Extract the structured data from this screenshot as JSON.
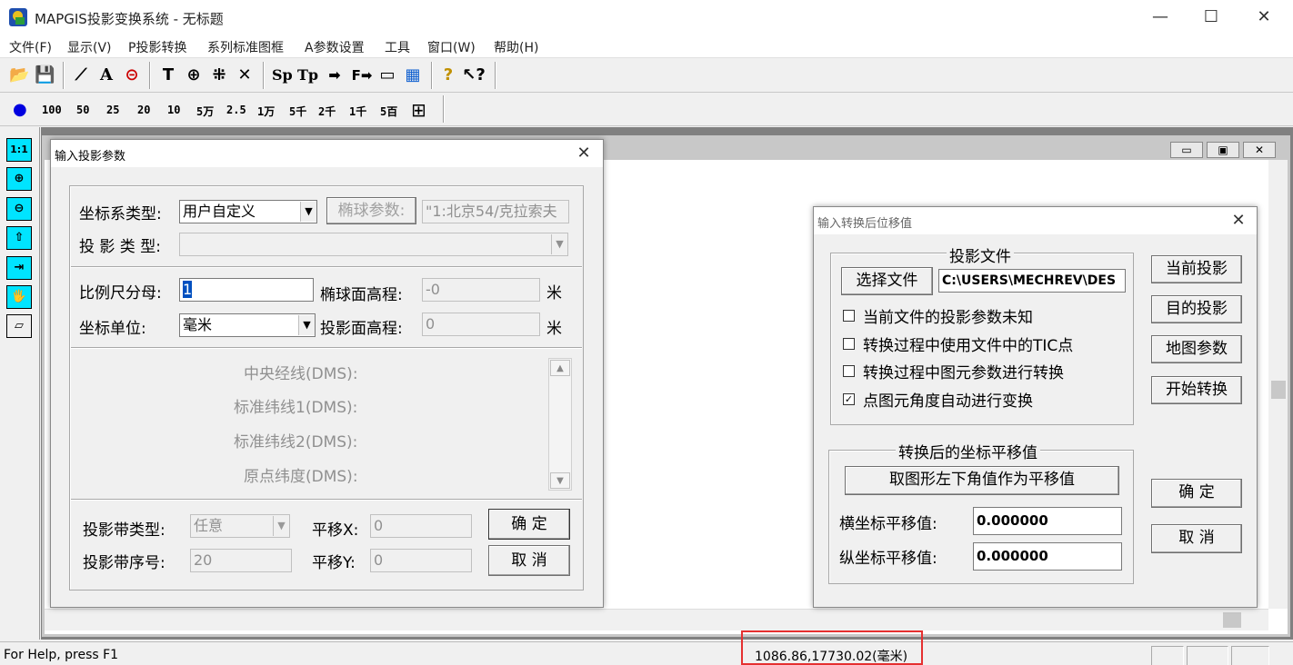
{
  "app": {
    "title": "MAPGIS投影变换系统 - 无标题",
    "minimize": "—",
    "maximize": "☐",
    "close": "✕"
  },
  "menu": [
    "文件(F)",
    "显示(V)",
    "P投影转换",
    "系列标准图框",
    "A参数设置",
    "工具",
    "窗口(W)",
    "帮助(H)"
  ],
  "toolbar1": [
    "📂",
    "💾",
    "⟋",
    "A",
    "⊝",
    "T",
    "⊕",
    "⁜",
    "✕",
    "Sp",
    "Tp",
    "➡",
    "F➡",
    "▭",
    "▦",
    "?",
    "↖?"
  ],
  "toolbar2": {
    "dot": "●",
    "scales": [
      "100",
      "50",
      "25",
      "20",
      "10",
      "5万",
      "2.5",
      "1万",
      "5千",
      "2千",
      "1千",
      "5百"
    ],
    "grid": "⊞"
  },
  "lefttools": [
    "1:1",
    "⊕",
    "⊖",
    "⇧",
    "⇥",
    "🖐",
    "▱"
  ],
  "doc": {
    "min": "▭",
    "restore": "▣",
    "close": "✕"
  },
  "status": {
    "help": "For Help, press F1",
    "coord": "1086.86,17730.02(毫米)"
  },
  "proj_dialog": {
    "title": "输入投影参数",
    "close": "✕",
    "coord_type_label": "坐标系类型:",
    "coord_type_value": "用户自定义",
    "ellipsoid_btn": "椭球参数:",
    "ellipsoid_value": "\"1:北京54/克拉索夫",
    "proj_type_label": "投 影 类 型:",
    "scale_label": "比例尺分母:",
    "scale_value": "1",
    "ell_height_label": "椭球面高程:",
    "ell_height_value": "-0",
    "unit_m1": "米",
    "unit_label": "坐标单位:",
    "unit_value": "毫米",
    "proj_height_label": "投影面高程:",
    "proj_height_value": "0",
    "unit_m2": "米",
    "param_labels": [
      "中央经线(DMS):",
      "标准纬线1(DMS):",
      "标准纬线2(DMS):",
      "原点纬度(DMS):"
    ],
    "zone_type_label": "投影带类型:",
    "zone_type_value": "任意",
    "zone_no_label": "投影带序号:",
    "zone_no_value": "20",
    "shift_x_label": "平移X:",
    "shift_x_value": "0",
    "shift_y_label": "平移Y:",
    "shift_y_value": "0",
    "ok": "确 定",
    "cancel": "取 消"
  },
  "shift_dialog": {
    "title": "输入转换后位移值",
    "close": "✕",
    "group1_title": "投影文件",
    "select_file_btn": "选择文件",
    "file_path": "C:\\USERS\\MECHREV\\DES",
    "checks": [
      {
        "label": "当前文件的投影参数未知",
        "checked": false
      },
      {
        "label": "转换过程中使用文件中的TIC点",
        "checked": false
      },
      {
        "label": "转换过程中图元参数进行转换",
        "checked": false
      },
      {
        "label": "点图元角度自动进行变换",
        "checked": true
      }
    ],
    "check_mark": "✓",
    "btn_current": "当前投影",
    "btn_target": "目的投影",
    "btn_map": "地图参数",
    "btn_start": "开始转换",
    "group2_title": "转换后的坐标平移值",
    "lower_left_btn": "取图形左下角值作为平移值",
    "x_label": "横坐标平移值:",
    "x_value": "0.000000",
    "y_label": "纵坐标平移值:",
    "y_value": "0.000000",
    "ok": "确 定",
    "cancel": "取 消"
  }
}
